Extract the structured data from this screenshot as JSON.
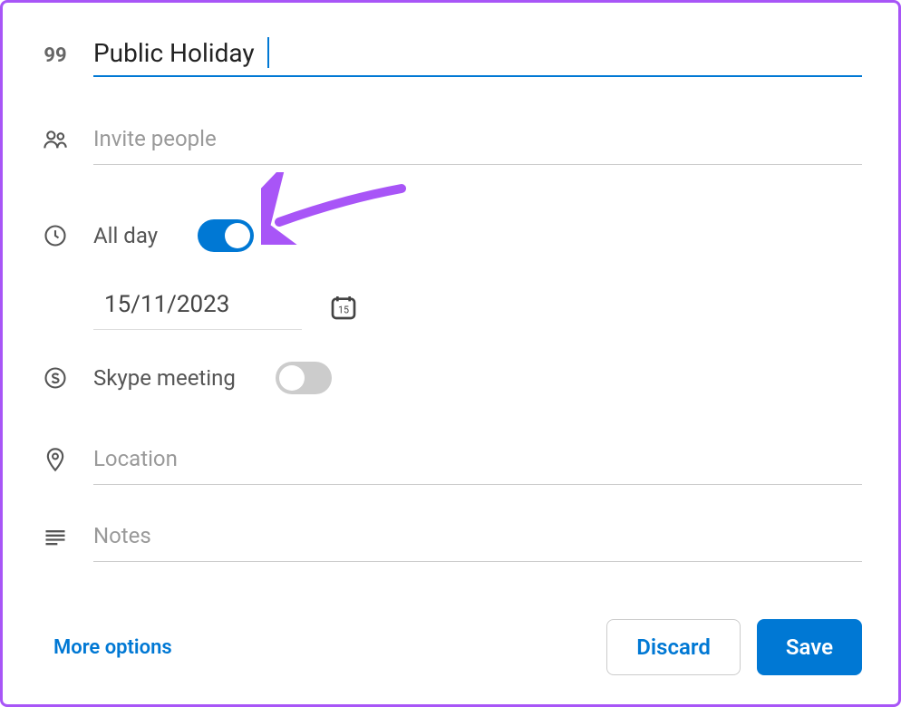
{
  "title": {
    "value": "Public Holiday"
  },
  "invite": {
    "placeholder": "Invite people"
  },
  "allday": {
    "label": "All day",
    "enabled": true
  },
  "date": {
    "value": "15/11/2023",
    "calendar_day": "15"
  },
  "skype": {
    "label": "Skype meeting",
    "enabled": false
  },
  "location": {
    "placeholder": "Location"
  },
  "notes": {
    "placeholder": "Notes"
  },
  "footer": {
    "more_options": "More options",
    "discard": "Discard",
    "save": "Save"
  },
  "colors": {
    "accent": "#0078d4",
    "arrow": "#a855f7"
  }
}
